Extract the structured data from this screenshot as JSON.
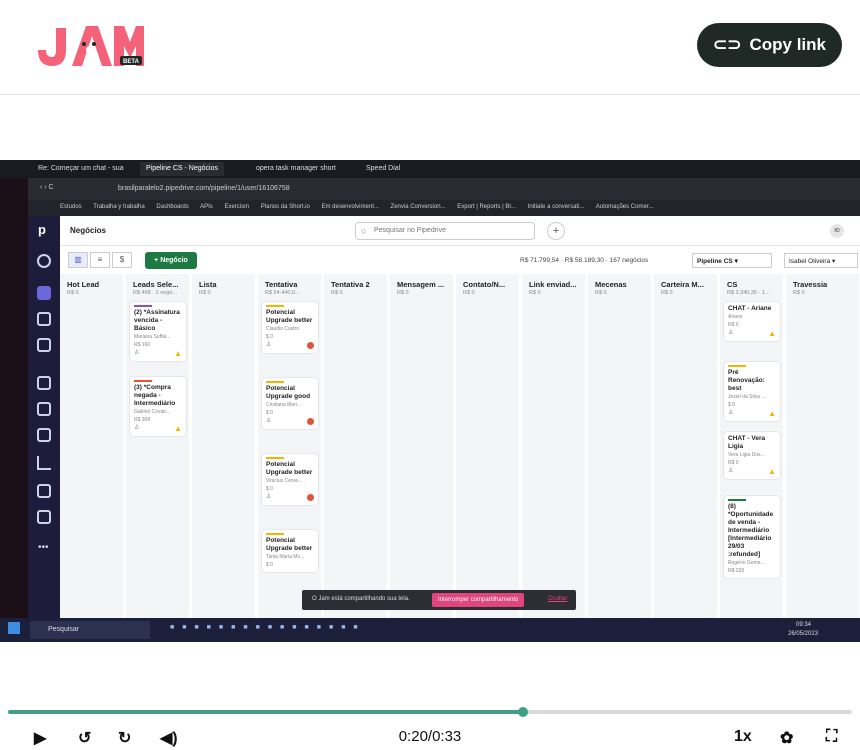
{
  "header": {
    "copy_label": "Copy link",
    "logo_badge": "BETA"
  },
  "browser": {
    "tabs": [
      "Re: Começar um chat - sua",
      "Pipeline CS - Negócios",
      "opera task manager short",
      "Speed Dial"
    ],
    "url": "brasilparalelo2.pipedrive.com/pipeline/1/user/16106758",
    "bookmarks": [
      "Estudos",
      "Trabalha y trabalha",
      "Dashboards",
      "APIs",
      "Exercism",
      "Planos da Short.io",
      "Em desenvolviment...",
      "Zenvia Conversion...",
      "Export | Reports | Br...",
      "Initiate a conversati...",
      "Automações Comer..."
    ]
  },
  "app": {
    "section": "Negócios",
    "search_placeholder": "Pesquisar no Pipedrive",
    "new_deal": "+ Negócio",
    "summary": "R$ 71.799,54 · R$ 58.189,30 · 167 negócios",
    "pipeline": "Pipeline CS ▾",
    "user": "Isabel Oliveira ▾",
    "columns": [
      {
        "name": "Hot Lead",
        "sum": "R$ 0"
      },
      {
        "name": "Leads Sele...",
        "sum": "R$ 468 · 2 negó..."
      },
      {
        "name": "Lista",
        "sum": "R$ 0"
      },
      {
        "name": "Tentativa",
        "sum": "R$ 54.440,0..."
      },
      {
        "name": "Tentativa 2",
        "sum": "R$ 0"
      },
      {
        "name": "Mensagem ...",
        "sum": "R$ 0"
      },
      {
        "name": "Contato/N...",
        "sum": "R$ 0"
      },
      {
        "name": "Link enviad...",
        "sum": "R$ 0"
      },
      {
        "name": "Mecenas",
        "sum": "R$ 0"
      },
      {
        "name": "Carteira M...",
        "sum": "R$ 0"
      },
      {
        "name": "CS",
        "sum": "R$ 3.340,35 · 1..."
      },
      {
        "name": "Travessia",
        "sum": "R$ 0"
      }
    ],
    "cards_leads": [
      {
        "title": "(2) *Assinatura vencida - Básico",
        "owner": "Mariana Suffal...",
        "value": "R$ 160"
      },
      {
        "title": "(3) *Compra negada - Intermediário",
        "owner": "Gabriel Covalc...",
        "value": "R$ 308"
      }
    ],
    "cards_tentativa": [
      {
        "title": "Potencial Upgrade better",
        "owner": "Claudio Castro",
        "value": "$ 0"
      },
      {
        "title": "Potencial Upgrade good",
        "owner": "Cristiana Mari...",
        "value": "$ 0"
      },
      {
        "title": "Potencial Upgrade better",
        "owner": "Vinicius Cerva...",
        "value": "$ 0"
      },
      {
        "title": "Potencial Upgrade better",
        "owner": "Tania Maria Mo...",
        "value": "$ 0"
      }
    ],
    "cards_cs": [
      {
        "title": "CHAT - Ariane",
        "owner": "Ariane",
        "value": "R$ 0"
      },
      {
        "title": "Pré Renovação: best",
        "owner": "Jeziel da Silva ...",
        "value": "$ 0"
      },
      {
        "title": "CHAT - Vera Ligia",
        "owner": "Vera Ligia Dos...",
        "value": "R$ 0"
      },
      {
        "title": "(8) *Oportunidade de venda - Intermediário [Intermediário 29/03 :refunded]",
        "owner": "Rogério Gome...",
        "value": "R$ 228"
      }
    ]
  },
  "share": {
    "text": "O Jam está compartilhando sua tela.",
    "stop": "Interromper compartilhamento",
    "hide": "Ocultar"
  },
  "taskbar": {
    "search": "Pesquisar",
    "clock": "09:34",
    "date": "26/05/2023"
  },
  "player": {
    "time": "0:20/0:33",
    "progress": 0.61,
    "speed": "1x"
  }
}
